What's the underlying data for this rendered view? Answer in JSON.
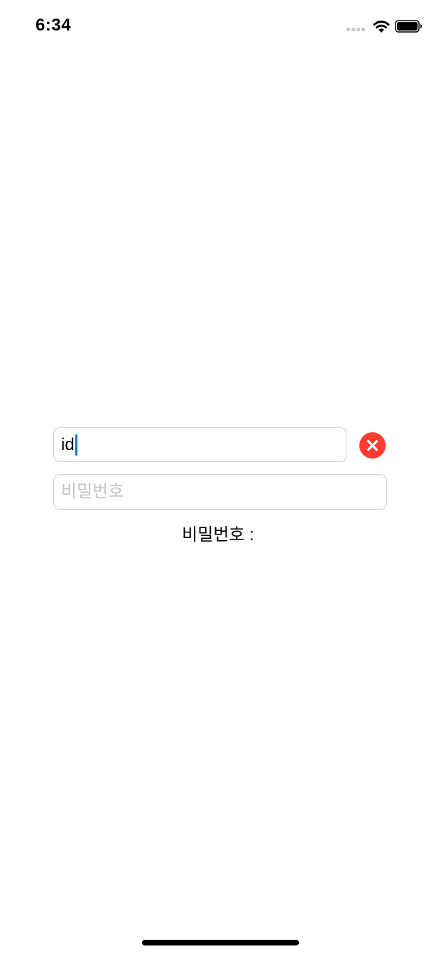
{
  "status_bar": {
    "time": "6:34",
    "icons": [
      "cellular-signal-icon",
      "wifi-icon",
      "battery-icon"
    ]
  },
  "form": {
    "id_field": {
      "value": "id"
    },
    "clear_button": {
      "icon": "close-icon",
      "color": "#ff3b30"
    },
    "password_field": {
      "placeholder": "비밀번호",
      "value": ""
    },
    "password_label": "비밀번호 :"
  },
  "colors": {
    "caret": "#1a73e8",
    "clear_button": "#ff3b30",
    "field_border": "#d1d1d6",
    "placeholder": "#c4c4c7"
  }
}
